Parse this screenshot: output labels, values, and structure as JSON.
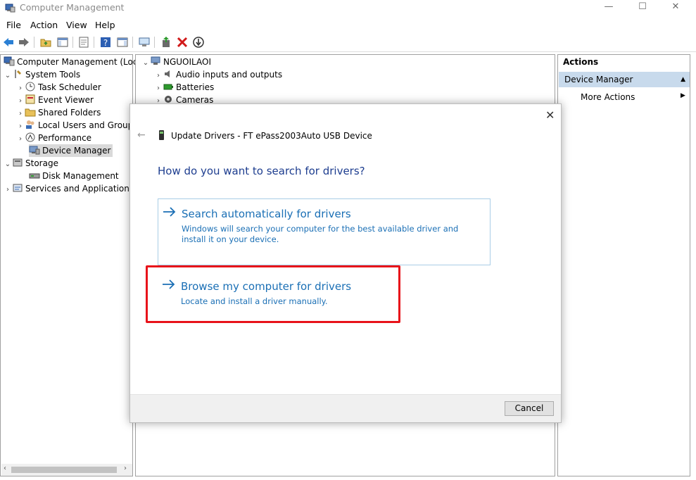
{
  "window": {
    "title": "Computer Management",
    "min_glyph": "—",
    "max_glyph": "☐",
    "close_glyph": "✕"
  },
  "menu": [
    "File",
    "Action",
    "View",
    "Help"
  ],
  "tree": {
    "root": "Computer Management (Local",
    "system_tools": "System Tools",
    "task_scheduler": "Task Scheduler",
    "event_viewer": "Event Viewer",
    "shared_folders": "Shared Folders",
    "local_users": "Local Users and Groups",
    "performance": "Performance",
    "device_manager": "Device Manager",
    "storage": "Storage",
    "disk_management": "Disk Management",
    "services": "Services and Applications"
  },
  "devices": {
    "computer": "NGUOILAOI",
    "audio": "Audio inputs and outputs",
    "batteries": "Batteries",
    "cameras": "Cameras"
  },
  "actions": {
    "header": "Actions",
    "section": "Device Manager",
    "more": "More Actions"
  },
  "dialog": {
    "title": "Update Drivers - FT ePass2003Auto USB Device",
    "heading": "How do you want to search for drivers?",
    "auto_title": "Search automatically for drivers",
    "auto_desc": "Windows will search your computer for the best available driver and install it on your device.",
    "browse_title": "Browse my computer for drivers",
    "browse_desc": "Locate and install a driver manually.",
    "cancel": "Cancel",
    "close_glyph": "✕",
    "back_glyph": "←"
  },
  "colors": {
    "link_blue": "#1a6fb5",
    "heading_blue": "#1d3d8f",
    "highlight_red": "#e8131a",
    "selection_blue": "#c8daec"
  }
}
